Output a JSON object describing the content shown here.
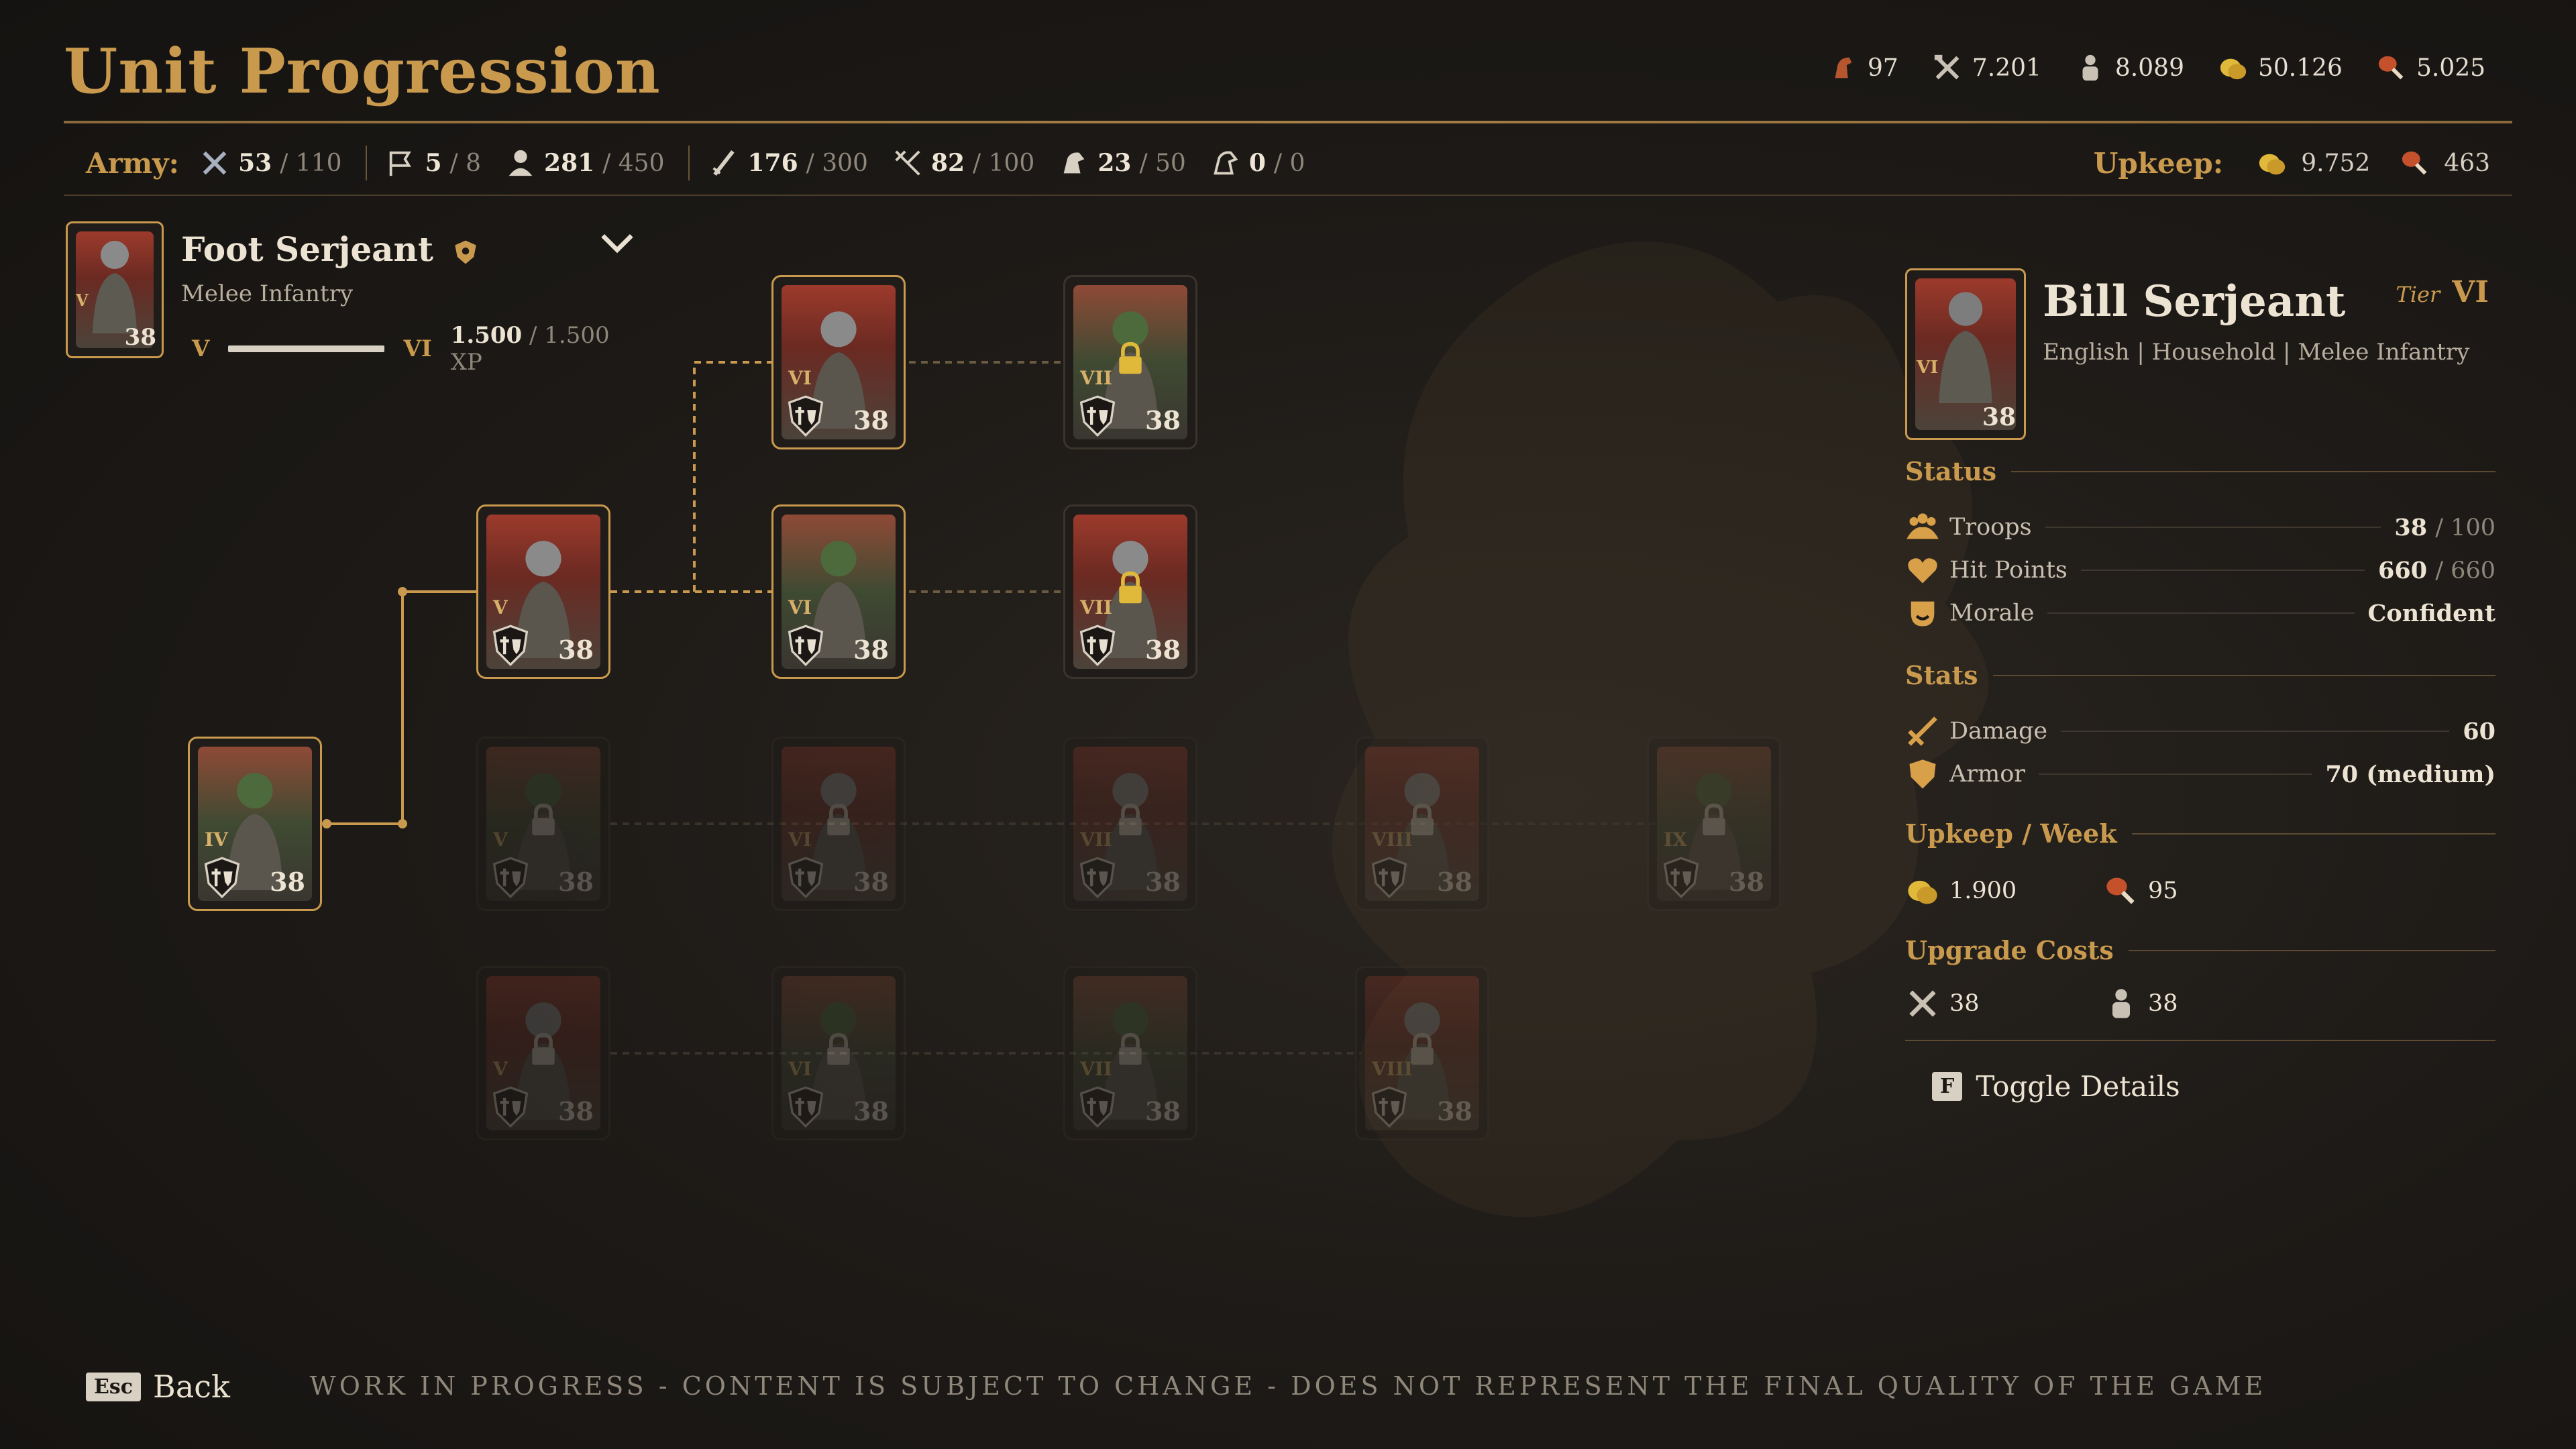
{
  "title": "Unit Progression",
  "resources": [
    {
      "icon": "horse-head-icon",
      "value": "97"
    },
    {
      "icon": "crossed-tools-icon",
      "value": "7.201"
    },
    {
      "icon": "population-icon",
      "value": "8.089"
    },
    {
      "icon": "gold-coins-icon",
      "value": "50.126"
    },
    {
      "icon": "food-drumstick-icon",
      "value": "5.025"
    }
  ],
  "army": {
    "label": "Army:",
    "stats": [
      {
        "icon": "crossed-swords-icon",
        "cur": "53",
        "max": "/ 110"
      },
      {
        "icon": "banner-icon",
        "cur": "5",
        "max": "/ 8"
      },
      {
        "icon": "soldier-icon",
        "cur": "281",
        "max": "/ 450"
      },
      {
        "icon": "sword-icon",
        "cur": "176",
        "max": "/ 300"
      },
      {
        "icon": "crossbow-icon",
        "cur": "82",
        "max": "/ 100"
      },
      {
        "icon": "cavalry-icon",
        "cur": "23",
        "max": "/ 50"
      },
      {
        "icon": "heavy-cavalry-icon",
        "cur": "0",
        "max": "/ 0"
      }
    ],
    "upkeep_label": "Upkeep:",
    "upkeep": [
      {
        "icon": "gold-coins-icon",
        "value": "9.752"
      },
      {
        "icon": "food-drumstick-icon",
        "value": "463"
      }
    ]
  },
  "selected_unit": {
    "name": "Foot Serjeant",
    "type": "Melee Infantry",
    "tier_from": "V",
    "tier_to": "VI",
    "xp_cur": "1.500",
    "xp_max": "/ 1.500 XP",
    "xp_fraction": 1.0,
    "portrait_tier": "V",
    "count": "38"
  },
  "tree": {
    "cards": [
      {
        "id": "c-iv",
        "tier": "IV",
        "count": "38",
        "state": "active",
        "tint": "green"
      },
      {
        "id": "c-v",
        "tier": "V",
        "count": "38",
        "state": "active",
        "tint": "red"
      },
      {
        "id": "c-vi-a",
        "tier": "VI",
        "count": "38",
        "state": "active",
        "tint": "red"
      },
      {
        "id": "c-vi-b",
        "tier": "VI",
        "count": "38",
        "state": "active",
        "tint": "green"
      },
      {
        "id": "c-vii-a",
        "tier": "VII",
        "count": "38",
        "state": "locked-visible",
        "tint": "green"
      },
      {
        "id": "c-vii-b",
        "tier": "VII",
        "count": "38",
        "state": "locked-visible",
        "tint": "red"
      },
      {
        "id": "r3-1",
        "tier": "V",
        "count": "38",
        "state": "locked",
        "tint": "green"
      },
      {
        "id": "r3-2",
        "tier": "VI",
        "count": "38",
        "state": "locked",
        "tint": "red"
      },
      {
        "id": "r3-3",
        "tier": "VII",
        "count": "38",
        "state": "locked",
        "tint": "red"
      },
      {
        "id": "r3-4",
        "tier": "VIII",
        "count": "38",
        "state": "locked",
        "tint": "red"
      },
      {
        "id": "r3-5",
        "tier": "IX",
        "count": "38",
        "state": "locked",
        "tint": "green"
      },
      {
        "id": "r4-1",
        "tier": "V",
        "count": "38",
        "state": "locked",
        "tint": "red"
      },
      {
        "id": "r4-2",
        "tier": "VI",
        "count": "38",
        "state": "locked",
        "tint": "green"
      },
      {
        "id": "r4-3",
        "tier": "VII",
        "count": "38",
        "state": "locked",
        "tint": "green"
      },
      {
        "id": "r4-4",
        "tier": "VIII",
        "count": "38",
        "state": "locked",
        "tint": "red"
      }
    ]
  },
  "detail": {
    "name": "Bill Serjeant",
    "subtitle": "English | Household | Melee Infantry",
    "tier_label": "Tier",
    "tier": "VI",
    "portrait_tier": "VI",
    "count": "38",
    "status_title": "Status",
    "troops_label": "Troops",
    "troops_cur": "38",
    "troops_max": "/ 100",
    "hp_label": "Hit Points",
    "hp_cur": "660",
    "hp_max": "/ 660",
    "morale_label": "Morale",
    "morale_val": "Confident",
    "stats_title": "Stats",
    "damage_label": "Damage",
    "damage_val": "60",
    "armor_label": "Armor",
    "armor_val": "70 (medium)",
    "upkeep_title": "Upkeep / Week",
    "upkeep_gold": "1.900",
    "upkeep_food": "95",
    "upgrade_title": "Upgrade Costs",
    "upgrade_tools": "38",
    "upgrade_pop": "38"
  },
  "toggle_key": "F",
  "toggle_label": "Toggle Details",
  "back_key": "Esc",
  "back_label": "Back",
  "wip_notice": "WORK IN PROGRESS - CONTENT IS SUBJECT TO CHANGE - DOES NOT REPRESENT THE FINAL QUALITY OF THE GAME"
}
